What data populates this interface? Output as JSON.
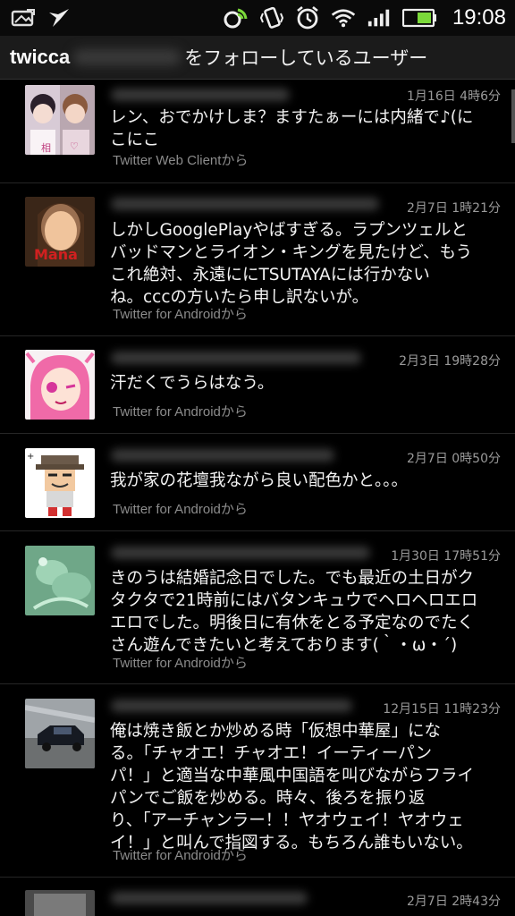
{
  "status_bar": {
    "time": "19:08",
    "left_icons": [
      "image-icon",
      "notification-bird-icon"
    ],
    "right_icons": [
      "nfc-icon",
      "vibrate-icon",
      "alarm-icon",
      "wifi-icon",
      "signal-icon",
      "battery-icon"
    ],
    "accent": "#7bd93a"
  },
  "title_bar": {
    "app_name": "twicca",
    "title_suffix": "をフォローしているユーザー"
  },
  "tweets": [
    {
      "timestamp": "1月16日 4時6分",
      "text": "レン、おでかけしま？ますたぁーには内緒で♪(に\nこにこ",
      "source": "Twitter Web Clientから"
    },
    {
      "timestamp": "2月7日 1時21分",
      "text": "しかしGooglePlayやばすぎる。ラプンツェルと\nバッドマンとライオン・キングを見たけど、もう\nこれ絶対、永遠ににTSUTAYAには行かない\nね。cccの方いたら申し訳ないが。",
      "source": "Twitter for Androidから"
    },
    {
      "timestamp": "2月3日 19時28分",
      "text": "汗だくでうらはなう。",
      "source": "Twitter for Androidから"
    },
    {
      "timestamp": "2月7日 0時50分",
      "text": "我が家の花壇我ながら良い配色かと。。。",
      "source": "Twitter for Androidから"
    },
    {
      "timestamp": "1月30日 17時51分",
      "text": "きのうは結婚記念日でした。でも最近の土日がク\nタクタで21時前にはバタンキュウでヘロヘロエロ\nエロでした。明後日に有休をとる予定なのでたく\nさん遊んできたいと考えております(｀・ω・´)",
      "source": "Twitter for Androidから"
    },
    {
      "timestamp": "12月15日 11時23分",
      "text": "俺は焼き飯とか炒める時「仮想中華屋」にな\nる。「チャオエ！チャオエ！イーティーパン\nパ！」と適当な中華風中国語を叫びながらフライ\nパンでご飯を炒める。時々、後ろを振り返\nり、「アーチャンラー！！ヤオウェイ！ヤオウェ\nイ！」と叫んで指図する。もちろん誰もいない。",
      "source": "Twitter for Androidから"
    },
    {
      "timestamp": "2月7日 2時43分",
      "text": "",
      "source": ""
    }
  ]
}
